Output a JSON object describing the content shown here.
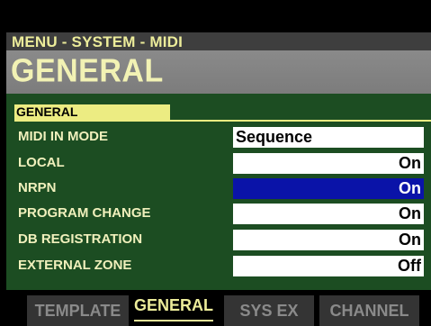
{
  "header": {
    "breadcrumb": "MENU - SYSTEM - MIDI",
    "title": "GENERAL"
  },
  "section": {
    "label": "GENERAL"
  },
  "rows": [
    {
      "label": "MIDI IN MODE",
      "value": "Sequence",
      "selected": false
    },
    {
      "label": "LOCAL",
      "value": "On",
      "selected": false
    },
    {
      "label": "NRPN",
      "value": "On",
      "selected": true
    },
    {
      "label": "PROGRAM CHANGE",
      "value": "On",
      "selected": false
    },
    {
      "label": "DB REGISTRATION",
      "value": "On",
      "selected": false
    },
    {
      "label": "EXTERNAL ZONE",
      "value": "Off",
      "selected": false
    }
  ],
  "tabs": [
    {
      "label": "TEMPLATE",
      "active": false
    },
    {
      "label": "GENERAL",
      "active": true
    },
    {
      "label": "SYS EX",
      "active": false
    },
    {
      "label": "CHANNEL",
      "active": false
    }
  ],
  "colors": {
    "panel_bg": "#1c4d22",
    "label_text": "#f0f0bc",
    "selected_value_bg": "#0a13a8",
    "value_bg": "#ffffff",
    "accent_yellow": "#ecec82"
  }
}
